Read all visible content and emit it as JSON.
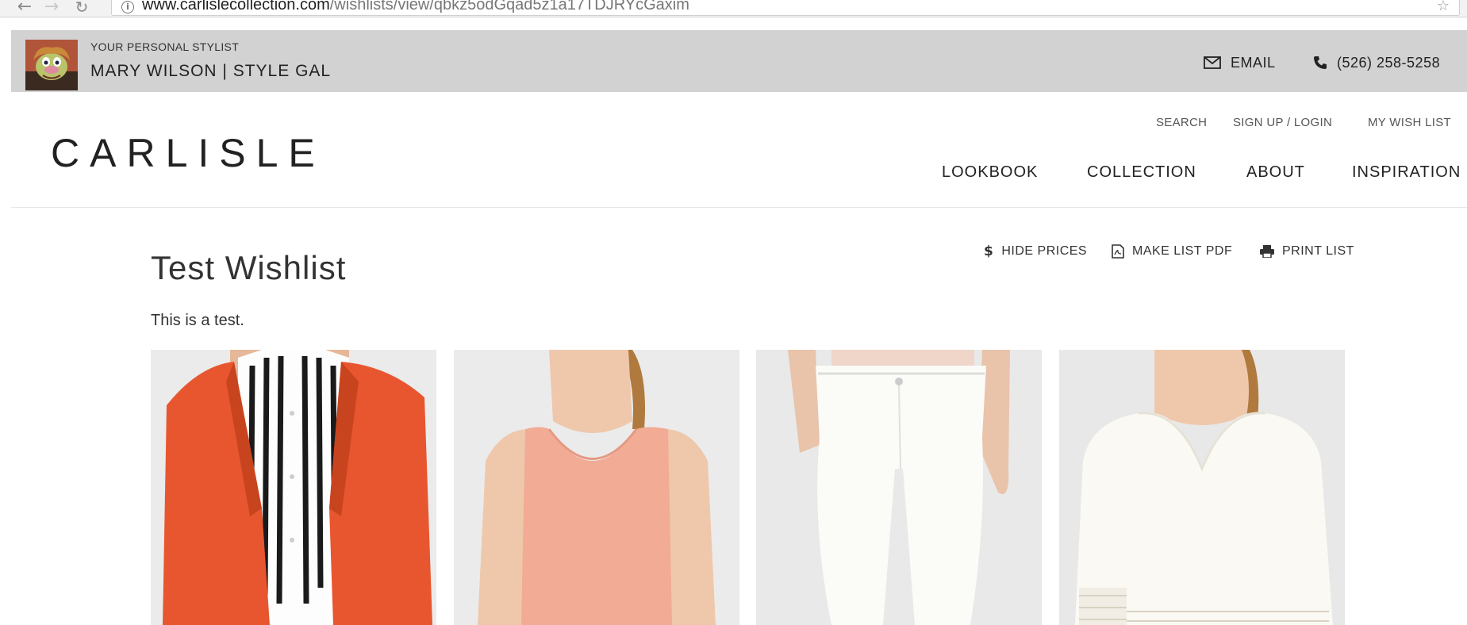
{
  "browser": {
    "url_host": "www.carlislecollection.com",
    "url_path": "/wishlists/view/qbkz5odGqad5z1a17TDJRYcGaxim"
  },
  "stylist_bar": {
    "label": "YOUR PERSONAL STYLIST",
    "name": "MARY WILSON | STYLE GAL",
    "email_label": "EMAIL",
    "phone": "(526) 258-5258"
  },
  "header": {
    "logo": "CARLISLE",
    "utility_links": [
      "SEARCH",
      "SIGN UP / LOGIN",
      "MY WISH LIST"
    ],
    "main_nav": [
      "LOOKBOOK",
      "COLLECTION",
      "ABOUT",
      "INSPIRATION"
    ]
  },
  "wishlist": {
    "title": "Test Wishlist",
    "description": "This is a test.",
    "tools": {
      "hide_prices": "HIDE PRICES",
      "make_pdf": "MAKE LIST PDF",
      "print": "PRINT LIST"
    },
    "products": [
      {
        "icon": "orange-blazer-striped-blouse-image"
      },
      {
        "icon": "peach-tank-top-image"
      },
      {
        "icon": "white-jeans-image"
      },
      {
        "icon": "white-lace-sweater-image"
      }
    ]
  },
  "colors": {
    "stylist_bar_bg": "#d2d2d2",
    "blazer": "#e8562f",
    "tank": "#f2ab95",
    "product_bg": "#ececec"
  }
}
